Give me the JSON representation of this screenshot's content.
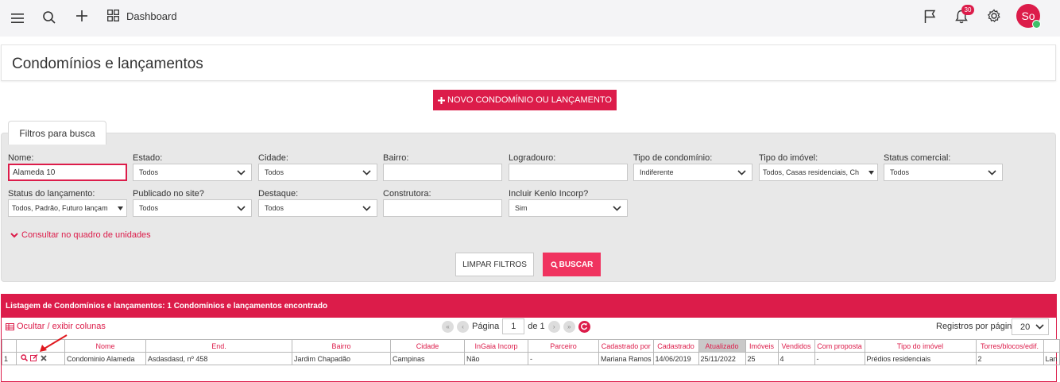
{
  "topbar": {
    "dashboard_label": "Dashboard",
    "notifications_count": "30",
    "avatar_initials": "So"
  },
  "page": {
    "title": "Condomínios e lançamentos",
    "new_button_label": "NOVO CONDOMÍNIO OU LANÇAMENTO"
  },
  "filters": {
    "tab_label": "Filtros para busca",
    "nome": {
      "label": "Nome:",
      "value": "Alameda 10"
    },
    "estado": {
      "label": "Estado:",
      "value": "Todos"
    },
    "cidade": {
      "label": "Cidade:",
      "value": "Todos"
    },
    "bairro": {
      "label": "Bairro:",
      "value": ""
    },
    "logradouro": {
      "label": "Logradouro:",
      "value": ""
    },
    "tipo_condominio": {
      "label": "Tipo de condomínio:",
      "value": "Indiferente"
    },
    "tipo_imovel": {
      "label": "Tipo do imóvel:",
      "value": "Todos, Casas residenciais, Ch"
    },
    "status_comercial": {
      "label": "Status comercial:",
      "value": "Todos"
    },
    "status_lancamento": {
      "label": "Status do lançamento:",
      "value": "Todos, Padrão, Futuro lançam"
    },
    "publicado": {
      "label": "Publicado no site?",
      "value": "Todos"
    },
    "destaque": {
      "label": "Destaque:",
      "value": "Todos"
    },
    "construtora": {
      "label": "Construtora:",
      "value": ""
    },
    "kenlo": {
      "label": "Incluir Kenlo Incorp?",
      "value": "Sim"
    },
    "consult_link": "Consultar no quadro de unidades",
    "clear_button": "LIMPAR FILTROS",
    "search_button": "BUSCAR"
  },
  "listing": {
    "header": "Listagem de Condomínios e lançamentos: 1 Condomínios e lançamentos encontrado",
    "toggle_columns": "Ocultar / exibir colunas",
    "page_label": "Página",
    "page_value": "1",
    "page_of": "de 1",
    "per_page_label": "Registros por página",
    "per_page_value": "20",
    "columns": [
      "Nome",
      "End.",
      "Bairro",
      "Cidade",
      "InGaia Incorp",
      "Parceiro",
      "Cadastrado por",
      "Cadastrado",
      "Atualizado",
      "Imóveis",
      "Vendidos",
      "Com proposta",
      "Tipo do imóvel",
      "Torres/blocos/edif."
    ],
    "rows": [
      {
        "index": "1",
        "cells": [
          "Condominio Alameda",
          "Asdasdasd, nº 458",
          "Jardim Chapadão",
          "Campinas",
          "Não",
          "-",
          "Mariana Ramos",
          "14/06/2019",
          "25/11/2022",
          "25",
          "4",
          "-",
          "Prédios residenciais",
          "2",
          "Lan"
        ]
      }
    ]
  },
  "colors": {
    "accent": "#dc1c4a",
    "filter_bg": "#e8e8e8",
    "topbar_bg": "#f4f4f6"
  }
}
